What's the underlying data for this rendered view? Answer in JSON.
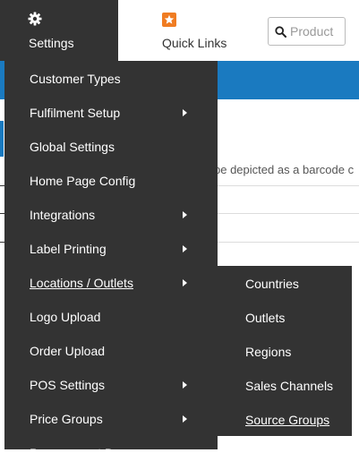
{
  "header": {
    "settings_label": "Settings",
    "settings_icon": "gear-icon",
    "quick_links_label": "Quick Links",
    "quick_links_icon": "star-icon",
    "search_placeholder": "Product",
    "search_icon": "search-icon"
  },
  "background": {
    "hint_text": "be depicted as a barcode c"
  },
  "colors": {
    "menu_bg": "#333333",
    "accent_blue": "#1a7ac0",
    "quick_links_orange": "#f07c22"
  },
  "settings_menu": {
    "items": [
      {
        "label": "Customer Types",
        "has_submenu": false
      },
      {
        "label": "Fulfilment Setup",
        "has_submenu": true
      },
      {
        "label": "Global Settings",
        "has_submenu": false
      },
      {
        "label": "Home Page Config",
        "has_submenu": false
      },
      {
        "label": "Integrations",
        "has_submenu": true
      },
      {
        "label": "Label Printing",
        "has_submenu": true
      },
      {
        "label": "Locations / Outlets",
        "has_submenu": true,
        "active": true
      },
      {
        "label": "Logo Upload",
        "has_submenu": false
      },
      {
        "label": "Order Upload",
        "has_submenu": false
      },
      {
        "label": "POS Settings",
        "has_submenu": true
      },
      {
        "label": "Price Groups",
        "has_submenu": true
      },
      {
        "label": "Procurement D",
        "has_submenu": false
      }
    ]
  },
  "locations_submenu": {
    "items": [
      {
        "label": "Countries"
      },
      {
        "label": "Outlets"
      },
      {
        "label": "Regions"
      },
      {
        "label": "Sales Channels"
      },
      {
        "label": "Source Groups",
        "hovered": true
      }
    ]
  }
}
